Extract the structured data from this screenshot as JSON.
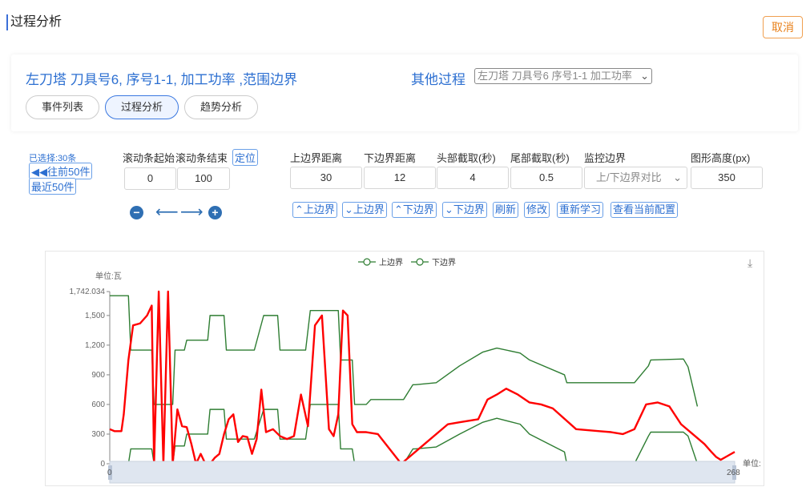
{
  "page": {
    "title": "过程分析",
    "cancel_label": "取消"
  },
  "card": {
    "title": "左刀塔  刀具号6,  序号1-1,  加工功率  ,范围边界",
    "other_label": "其他过程",
    "other_select_value": "左刀塔 刀具号6 序号1-1 加工功率",
    "tabs": [
      {
        "label": "事件列表"
      },
      {
        "label": "过程分析"
      },
      {
        "label": "趋势分析"
      }
    ]
  },
  "selection": {
    "selected": "已选择:30条",
    "prev50": "◀◀往前50件",
    "recent50": "最近50件"
  },
  "scroll": {
    "start_label": "滚动条起始",
    "end_label": "滚动条结束",
    "start_value": "0",
    "end_value": "100",
    "locate_label": "定位"
  },
  "params": {
    "labels": [
      "上边界距离",
      "下边界距离",
      "头部截取(秒)",
      "尾部截取(秒)",
      "监控边界",
      "图形高度(px)"
    ],
    "values": [
      "30",
      "12",
      "4",
      "0.5",
      "上/下边界对比",
      "350"
    ]
  },
  "actions": [
    "⌃上边界",
    "⌄上边界",
    "⌃下边界",
    "⌄下边界",
    "刷新",
    "修改",
    "重新学习",
    "查看当前配置"
  ],
  "icons": {
    "minus": "minus-circle-icon",
    "left": "arrow-left-icon",
    "right": "arrow-right-icon",
    "plus": "plus-circle-icon",
    "download": "download-icon"
  },
  "colors": {
    "accent": "#2c6fd1",
    "boundary": "#2e7d32",
    "signal": "#ff0000",
    "cancel": "#e8801a"
  },
  "chart_data": {
    "type": "line",
    "unit_y": "单位:瓦",
    "unit_x": "单位:",
    "ylim": [
      0,
      1742.034
    ],
    "y_ticks": [
      "0",
      "300",
      "600",
      "900",
      "1,200",
      "1,500",
      "1,742.034"
    ],
    "x_ticks": [
      "0",
      "268"
    ],
    "legend": [
      "上边界",
      "下边界"
    ],
    "legend_position": "top-center",
    "series": [
      {
        "name": "上边界",
        "x": [
          0,
          8,
          9,
          18,
          19,
          27,
          28,
          32,
          33,
          42,
          43,
          49,
          50,
          62,
          66,
          72,
          73,
          84,
          86,
          98,
          99,
          104,
          105,
          110,
          112,
          125,
          126,
          130,
          131,
          140,
          150,
          160,
          166,
          176,
          180,
          195,
          196,
          210,
          225,
          231,
          232,
          246,
          248,
          252
        ],
        "y": [
          1700,
          1700,
          1150,
          1150,
          600,
          600,
          1150,
          1150,
          1250,
          1250,
          1500,
          1500,
          1150,
          1150,
          1500,
          1500,
          1150,
          1150,
          1550,
          1550,
          1050,
          1050,
          600,
          600,
          650,
          650,
          650,
          800,
          800,
          820,
          990,
          1130,
          1170,
          1120,
          1050,
          900,
          820,
          820,
          820,
          990,
          1050,
          1060,
          980,
          580
        ]
      },
      {
        "name": "下边界",
        "x": [
          0,
          8,
          9,
          18,
          19,
          27,
          28,
          32,
          33,
          42,
          43,
          49,
          50,
          62,
          66,
          72,
          73,
          84,
          86,
          98,
          99,
          104,
          105,
          110,
          112,
          125,
          126,
          130,
          131,
          140,
          150,
          160,
          166,
          176,
          180,
          195,
          196,
          210,
          225,
          231,
          232,
          246,
          248,
          252
        ],
        "y": [
          0,
          0,
          150,
          150,
          0,
          0,
          180,
          180,
          300,
          300,
          550,
          550,
          250,
          250,
          550,
          550,
          250,
          250,
          600,
          600,
          150,
          150,
          0,
          0,
          0,
          0,
          0,
          150,
          150,
          170,
          300,
          420,
          460,
          400,
          300,
          120,
          0,
          0,
          0,
          280,
          320,
          320,
          280,
          0
        ]
      },
      {
        "name": "",
        "x": [
          0,
          2,
          5,
          6,
          8,
          10,
          13,
          16,
          18,
          19,
          21,
          23,
          25,
          27,
          29,
          31,
          33,
          35,
          37,
          39,
          41,
          43,
          45,
          47,
          49,
          51,
          53,
          55,
          57,
          59,
          61,
          63,
          65,
          67,
          70,
          73,
          76,
          79,
          82,
          85,
          88,
          91,
          94,
          96,
          98,
          100,
          102,
          104,
          106,
          110,
          115,
          125,
          135,
          145,
          150,
          158,
          162,
          166,
          170,
          175,
          180,
          185,
          190,
          200,
          210,
          215,
          220,
          225,
          230,
          235,
          240,
          245,
          250,
          255,
          258,
          260,
          262,
          265,
          268
        ],
        "y": [
          350,
          330,
          330,
          500,
          1050,
          1400,
          1420,
          1500,
          1600,
          0,
          1750,
          0,
          1750,
          0,
          550,
          380,
          370,
          200,
          0,
          100,
          0,
          0,
          60,
          100,
          300,
          450,
          500,
          220,
          280,
          270,
          100,
          250,
          750,
          320,
          350,
          280,
          250,
          280,
          700,
          380,
          1400,
          1500,
          350,
          280,
          500,
          1550,
          1500,
          400,
          320,
          320,
          300,
          0,
          200,
          400,
          420,
          450,
          650,
          700,
          760,
          700,
          620,
          600,
          560,
          350,
          330,
          320,
          300,
          350,
          600,
          620,
          580,
          400,
          300,
          200,
          120,
          70,
          40,
          80,
          120
        ]
      }
    ]
  }
}
